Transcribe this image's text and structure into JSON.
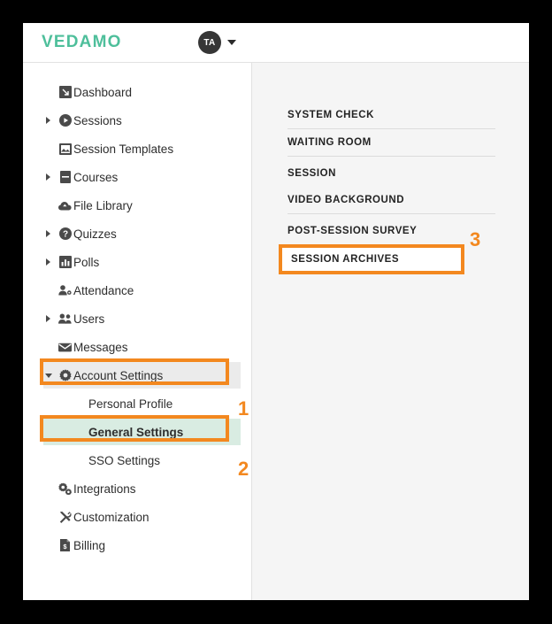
{
  "header": {
    "brand": "VEDAMO",
    "avatar_initials": "TA",
    "caret_icon": "chevron-down-icon"
  },
  "sidebar": {
    "items": [
      {
        "label": "Dashboard",
        "icon": "dashboard-icon",
        "arrow": "none",
        "level": 0,
        "state": "normal"
      },
      {
        "label": "Sessions",
        "icon": "play-circle-icon",
        "arrow": "collapsed",
        "level": 0,
        "state": "normal"
      },
      {
        "label": "Session Templates",
        "icon": "image-frame-icon",
        "arrow": "none",
        "level": 0,
        "state": "normal"
      },
      {
        "label": "Courses",
        "icon": "book-icon",
        "arrow": "collapsed",
        "level": 0,
        "state": "normal"
      },
      {
        "label": "File Library",
        "icon": "cloud-icon",
        "arrow": "none",
        "level": 0,
        "state": "normal"
      },
      {
        "label": "Quizzes",
        "icon": "question-circle-icon",
        "arrow": "collapsed",
        "level": 0,
        "state": "normal"
      },
      {
        "label": "Polls",
        "icon": "bar-chart-icon",
        "arrow": "collapsed",
        "level": 0,
        "state": "normal"
      },
      {
        "label": "Attendance",
        "icon": "person-badge-icon",
        "arrow": "none",
        "level": 0,
        "state": "normal"
      },
      {
        "label": "Users",
        "icon": "users-icon",
        "arrow": "collapsed",
        "level": 0,
        "state": "normal"
      },
      {
        "label": "Messages",
        "icon": "envelope-icon",
        "arrow": "none",
        "level": 0,
        "state": "normal"
      },
      {
        "label": "Account Settings",
        "icon": "gear-icon",
        "arrow": "expanded",
        "level": 0,
        "state": "expanded-highlight"
      },
      {
        "label": "Personal Profile",
        "icon": "none",
        "arrow": "none",
        "level": 1,
        "state": "normal"
      },
      {
        "label": "General Settings",
        "icon": "none",
        "arrow": "none",
        "level": 1,
        "state": "selected-highlight"
      },
      {
        "label": "SSO Settings",
        "icon": "none",
        "arrow": "none",
        "level": 1,
        "state": "normal"
      },
      {
        "label": "Integrations",
        "icon": "gears-icon",
        "arrow": "none",
        "level": 0,
        "state": "normal"
      },
      {
        "label": "Customization",
        "icon": "tools-icon",
        "arrow": "none",
        "level": 0,
        "state": "normal"
      },
      {
        "label": "Billing",
        "icon": "invoice-icon",
        "arrow": "none",
        "level": 0,
        "state": "normal"
      }
    ]
  },
  "panel": {
    "items": [
      {
        "label": "SYSTEM CHECK",
        "divider_after": false,
        "boxed": false
      },
      {
        "label": "WAITING ROOM",
        "divider_after": true,
        "boxed": false
      },
      {
        "label": "SESSION",
        "divider_after": false,
        "boxed": false
      },
      {
        "label": "VIDEO BACKGROUND",
        "divider_after": true,
        "boxed": false
      },
      {
        "label": "POST-SESSION SURVEY",
        "divider_after": false,
        "boxed": false
      },
      {
        "label": "SESSION ARCHIVES",
        "divider_after": false,
        "boxed": true
      }
    ]
  },
  "annotations": {
    "markers": [
      {
        "number": "1",
        "target": "Account Settings"
      },
      {
        "number": "2",
        "target": "General Settings"
      },
      {
        "number": "3",
        "target": "SESSION ARCHIVES"
      }
    ],
    "highlight_color": "#f3881f"
  },
  "colors": {
    "brand": "#4ebf9b",
    "highlight": "#f3881f",
    "selected_row": "#d9ece2",
    "expanded_row": "#ebebeb",
    "panel_bg": "#f5f5f5",
    "avatar_bg": "#363636"
  }
}
